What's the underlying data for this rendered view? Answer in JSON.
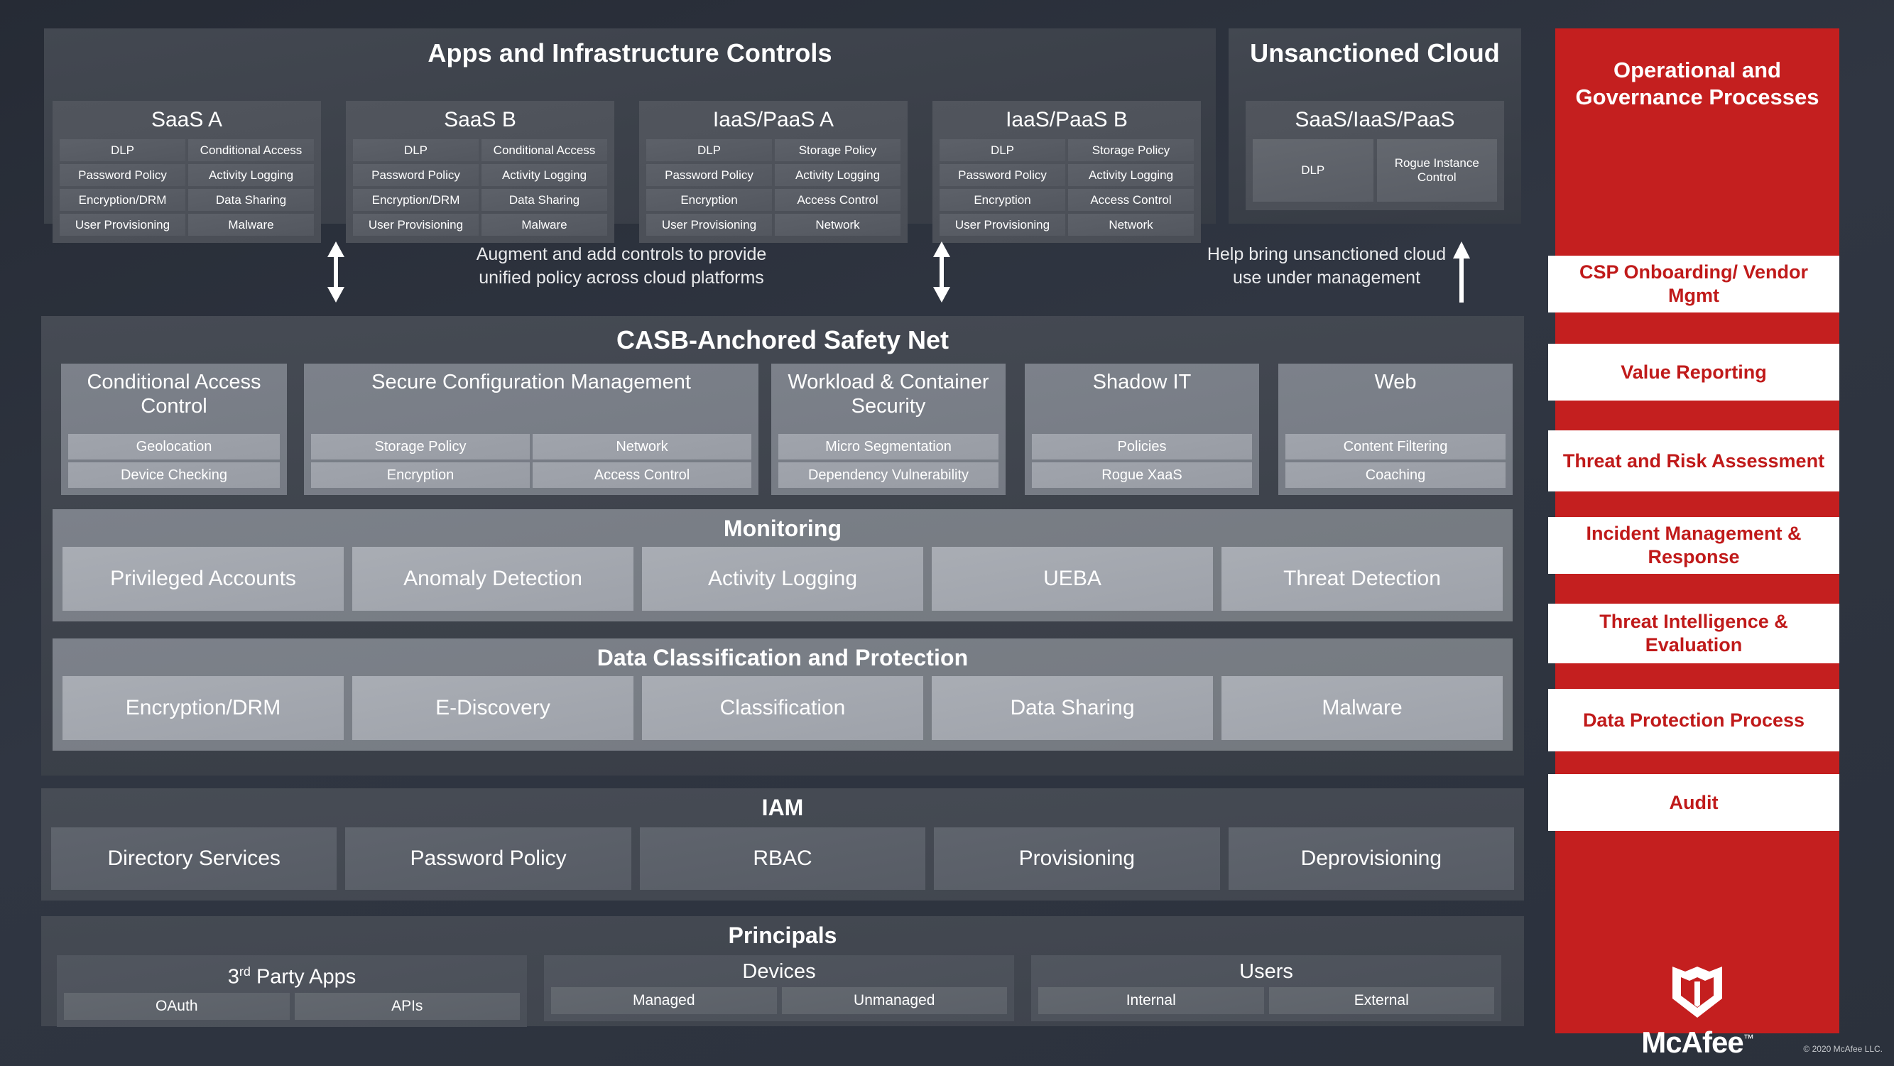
{
  "colors": {
    "brand_red": "#c41f1f",
    "rail_text_red": "#c01a1a",
    "background": "#2a2f3a",
    "panel_gray": "#4a4e56"
  },
  "apps_panel": {
    "title": "Apps and Infrastructure Controls",
    "providers": [
      {
        "name": "SaaS A",
        "controls": [
          "DLP",
          "Conditional Access",
          "Password Policy",
          "Activity Logging",
          "Encryption/DRM",
          "Data Sharing",
          "User Provisioning",
          "Malware"
        ]
      },
      {
        "name": "SaaS B",
        "controls": [
          "DLP",
          "Conditional Access",
          "Password Policy",
          "Activity Logging",
          "Encryption/DRM",
          "Data Sharing",
          "User Provisioning",
          "Malware"
        ]
      },
      {
        "name": "IaaS/PaaS A",
        "controls": [
          "DLP",
          "Storage Policy",
          "Password Policy",
          "Activity Logging",
          "Encryption",
          "Access Control",
          "User Provisioning",
          "Network"
        ]
      },
      {
        "name": "IaaS/PaaS B",
        "controls": [
          "DLP",
          "Storage Policy",
          "Password Policy",
          "Activity Logging",
          "Encryption",
          "Access Control",
          "User Provisioning",
          "Network"
        ]
      }
    ]
  },
  "unsanctioned": {
    "title": "Unsanctioned Cloud",
    "group": "SaaS/IaaS/PaaS",
    "controls": [
      "DLP",
      "Rogue Instance Control"
    ]
  },
  "connectors": {
    "left_caption_line1": "Augment and add controls to provide",
    "left_caption_line2": "unified policy across cloud platforms",
    "right_caption_line1": "Help bring unsanctioned cloud",
    "right_caption_line2": "use under management"
  },
  "casb": {
    "title": "CASB-Anchored Safety Net",
    "columns": [
      {
        "title": "Conditional Access Control",
        "items": [
          "Geolocation",
          "Device Checking"
        ]
      },
      {
        "title": "Secure Configuration Management",
        "items": [
          "Storage Policy",
          "Network",
          "Encryption",
          "Access Control"
        ]
      },
      {
        "title": "Workload & Container Security",
        "items": [
          "Micro Segmentation",
          "Dependency Vulnerability"
        ]
      },
      {
        "title": "Shadow IT",
        "items": [
          "Policies",
          "Rogue XaaS"
        ]
      },
      {
        "title": "Web",
        "items": [
          "Content Filtering",
          "Coaching"
        ]
      }
    ],
    "monitoring": {
      "title": "Monitoring",
      "items": [
        "Privileged Accounts",
        "Anomaly Detection",
        "Activity Logging",
        "UEBA",
        "Threat Detection"
      ]
    },
    "data_classification": {
      "title": "Data Classification and Protection",
      "items": [
        "Encryption/DRM",
        "E-Discovery",
        "Classification",
        "Data Sharing",
        "Malware"
      ]
    }
  },
  "iam": {
    "title": "IAM",
    "items": [
      "Directory Services",
      "Password Policy",
      "RBAC",
      "Provisioning",
      "Deprovisioning"
    ]
  },
  "principals": {
    "title": "Principals",
    "groups": [
      {
        "title_html": "3<sup class=\"ord\">rd</sup> Party Apps",
        "title_text": "3rd Party Apps",
        "items": [
          "OAuth",
          "APIs"
        ]
      },
      {
        "title_html": "Devices",
        "title_text": "Devices",
        "items": [
          "Managed",
          "Unmanaged"
        ]
      },
      {
        "title_html": "Users",
        "title_text": "Users",
        "items": [
          "Internal",
          "External"
        ]
      }
    ]
  },
  "governance": {
    "title_line1": "Operational and",
    "title_line2": "Governance Processes",
    "items": [
      "CSP Onboarding/ Vendor Mgmt",
      "Value Reporting",
      "Threat and Risk Assessment",
      "Incident Management & Response",
      "Threat Intelligence & Evaluation",
      "Data Protection Process",
      "Audit"
    ]
  },
  "branding": {
    "logo_name": "mcafee-shield-logo",
    "wordmark": "McAfee",
    "trademark": "™",
    "copyright": "© 2020 McAfee LLC."
  }
}
